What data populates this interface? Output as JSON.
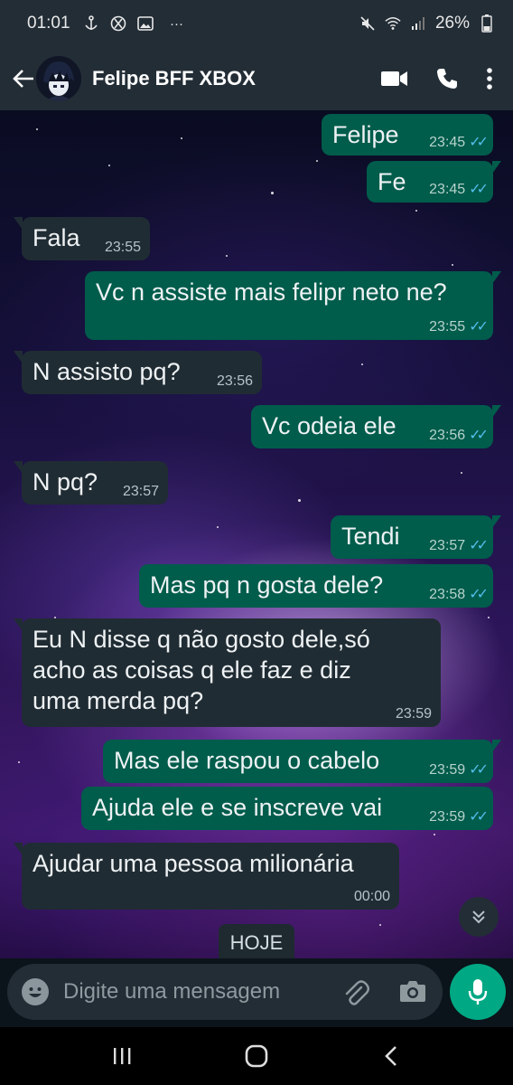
{
  "status_bar": {
    "time": "01:01",
    "battery": "26%",
    "icons": [
      "anchor-icon",
      "xbox-icon",
      "gallery-icon",
      "more-dots-icon",
      "mute-icon",
      "wifi-icon",
      "signal-icon",
      "battery-icon"
    ]
  },
  "header": {
    "contact_name": "Felipe BFF XBOX",
    "icons": [
      "back-arrow-icon",
      "video-call-icon",
      "phone-icon",
      "menu-dots-icon"
    ]
  },
  "messages": [
    {
      "dir": "out",
      "text": "Felipe",
      "time": "23:45",
      "read": true
    },
    {
      "dir": "out",
      "text": "Fe",
      "time": "23:45",
      "read": true
    },
    {
      "dir": "in",
      "text": "Fala",
      "time": "23:55"
    },
    {
      "dir": "out",
      "text": "Vc n assiste mais felipr neto ne?",
      "time": "23:55",
      "read": true
    },
    {
      "dir": "in",
      "text": "N assisto pq?",
      "time": "23:56"
    },
    {
      "dir": "out",
      "text": "Vc odeia ele",
      "time": "23:56",
      "read": true
    },
    {
      "dir": "in",
      "text": "N pq?",
      "time": "23:57"
    },
    {
      "dir": "out",
      "text": "Tendi",
      "time": "23:57",
      "read": true
    },
    {
      "dir": "out",
      "text": "Mas pq n gosta dele?",
      "time": "23:58",
      "read": true
    },
    {
      "dir": "in",
      "text_lines": [
        "Eu N disse q não gosto dele,só",
        "acho as coisas q ele faz e diz",
        "uma merda pq?"
      ],
      "time": "23:59"
    },
    {
      "dir": "out",
      "text": "Mas ele raspou o cabelo",
      "time": "23:59",
      "read": true
    },
    {
      "dir": "out",
      "text": "Ajuda ele e se inscreve vai",
      "time": "23:59",
      "read": true
    },
    {
      "dir": "in",
      "text": "Ajudar uma pessoa milionária",
      "time": "00:00"
    }
  ],
  "date_divider": "HOJE",
  "input": {
    "placeholder": "Digite uma mensagem"
  },
  "colors": {
    "outgoing_bubble": "#005c4b",
    "incoming_bubble": "#202c33",
    "read_ticks": "#53bdeb",
    "mic_button": "#00a884",
    "header": "#232d36"
  }
}
